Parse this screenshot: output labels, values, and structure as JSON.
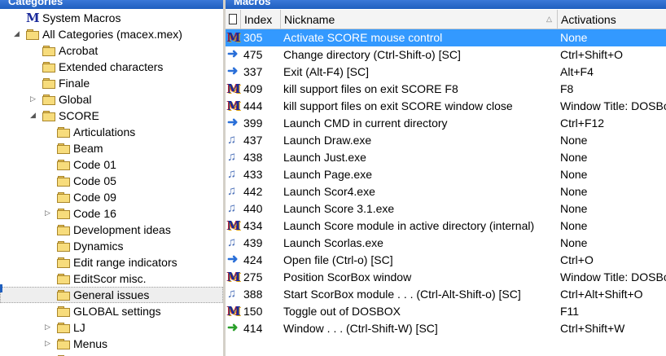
{
  "left_panel": {
    "title": "Categories"
  },
  "right_panel": {
    "title": "Macros"
  },
  "tree": [
    {
      "label": "System Macros",
      "icon": "m-macro-icon",
      "indent": 0,
      "exp": ""
    },
    {
      "label": "All Categories (macex.mex)",
      "icon": "folder-icon",
      "indent": 0,
      "exp": "open"
    },
    {
      "label": "Acrobat",
      "icon": "folder-icon",
      "indent": 1,
      "exp": ""
    },
    {
      "label": "Extended characters",
      "icon": "folder-icon",
      "indent": 1,
      "exp": ""
    },
    {
      "label": "Finale",
      "icon": "folder-icon",
      "indent": 1,
      "exp": ""
    },
    {
      "label": "Global",
      "icon": "folder-icon",
      "indent": 1,
      "exp": "closed"
    },
    {
      "label": "SCORE",
      "icon": "folder-icon",
      "indent": 1,
      "exp": "open"
    },
    {
      "label": "Articulations",
      "icon": "folder-icon",
      "indent": 2,
      "exp": ""
    },
    {
      "label": "Beam",
      "icon": "folder-icon",
      "indent": 2,
      "exp": ""
    },
    {
      "label": "Code 01",
      "icon": "folder-icon",
      "indent": 2,
      "exp": ""
    },
    {
      "label": "Code 05",
      "icon": "folder-icon",
      "indent": 2,
      "exp": ""
    },
    {
      "label": "Code 09",
      "icon": "folder-icon",
      "indent": 2,
      "exp": ""
    },
    {
      "label": "Code 16",
      "icon": "folder-icon",
      "indent": 2,
      "exp": "closed"
    },
    {
      "label": "Development ideas",
      "icon": "folder-icon",
      "indent": 2,
      "exp": ""
    },
    {
      "label": "Dynamics",
      "icon": "folder-icon",
      "indent": 2,
      "exp": ""
    },
    {
      "label": "Edit range indicators",
      "icon": "folder-icon",
      "indent": 2,
      "exp": ""
    },
    {
      "label": "EditScor misc.",
      "icon": "folder-icon",
      "indent": 2,
      "exp": ""
    },
    {
      "label": "General issues",
      "icon": "folder-icon",
      "indent": 2,
      "exp": "",
      "selected": true
    },
    {
      "label": "GLOBAL settings",
      "icon": "folder-icon",
      "indent": 2,
      "exp": ""
    },
    {
      "label": "LJ",
      "icon": "folder-icon",
      "indent": 2,
      "exp": "closed"
    },
    {
      "label": "Menus",
      "icon": "folder-icon",
      "indent": 2,
      "exp": "closed"
    },
    {
      "label": "",
      "icon": "folder-icon",
      "indent": 2,
      "exp": ""
    }
  ],
  "columns": {
    "index": "Index",
    "nickname": "Nickname",
    "activations": "Activations"
  },
  "macros": [
    {
      "icon": "m-macro-icon",
      "index": "305",
      "nickname": "Activate SCORE mouse control",
      "activation": "None",
      "selected": true
    },
    {
      "icon": "blue-arrow-icon",
      "index": "475",
      "nickname": "Change directory (Ctrl-Shift-o) [SC]",
      "activation": "Ctrl+Shift+O"
    },
    {
      "icon": "blue-arrow-icon",
      "index": "337",
      "nickname": "Exit (Alt-F4) [SC]",
      "activation": "Alt+F4"
    },
    {
      "icon": "m-macro-icon",
      "index": "409",
      "nickname": "kill support files on exit SCORE F8",
      "activation": "F8"
    },
    {
      "icon": "m-macro-icon",
      "index": "444",
      "nickname": "kill support files on exit SCORE window close",
      "activation": "Window Title: DOSBo"
    },
    {
      "icon": "blue-arrow-icon",
      "index": "399",
      "nickname": "Launch CMD in current directory",
      "activation": "Ctrl+F12"
    },
    {
      "icon": "music-note-icon",
      "index": "437",
      "nickname": "Launch Draw.exe",
      "activation": "None"
    },
    {
      "icon": "music-note-icon",
      "index": "438",
      "nickname": "Launch Just.exe",
      "activation": "None"
    },
    {
      "icon": "music-note-icon",
      "index": "433",
      "nickname": "Launch Page.exe",
      "activation": "None"
    },
    {
      "icon": "music-note-icon",
      "index": "442",
      "nickname": "Launch Scor4.exe",
      "activation": "None"
    },
    {
      "icon": "music-note-icon",
      "index": "440",
      "nickname": "Launch Score 3.1.exe",
      "activation": "None"
    },
    {
      "icon": "m-macro-icon",
      "index": "434",
      "nickname": "Launch Score module in active directory (internal)",
      "activation": "None"
    },
    {
      "icon": "music-note-icon",
      "index": "439",
      "nickname": "Launch Scorlas.exe",
      "activation": "None"
    },
    {
      "icon": "blue-arrow-icon",
      "index": "424",
      "nickname": "Open file (Ctrl-o) [SC]",
      "activation": "Ctrl+O"
    },
    {
      "icon": "m-macro-icon",
      "index": "275",
      "nickname": "Position ScorBox window",
      "activation": "Window Title: DOSBo"
    },
    {
      "icon": "music-note-icon",
      "index": "388",
      "nickname": "Start ScorBox module . . . (Ctrl-Alt-Shift-o) [SC]",
      "activation": "Ctrl+Alt+Shift+O"
    },
    {
      "icon": "m-macro-icon",
      "index": "150",
      "nickname": "Toggle out of DOSBOX",
      "activation": "F11"
    },
    {
      "icon": "green-arrow-icon",
      "index": "414",
      "nickname": "Window . . . (Ctrl-Shift-W) [SC]",
      "activation": "Ctrl+Shift+W"
    }
  ],
  "colors": {
    "selection": "#3399ff",
    "header": "#1f5fbf",
    "folder": "#f7dc7c"
  }
}
